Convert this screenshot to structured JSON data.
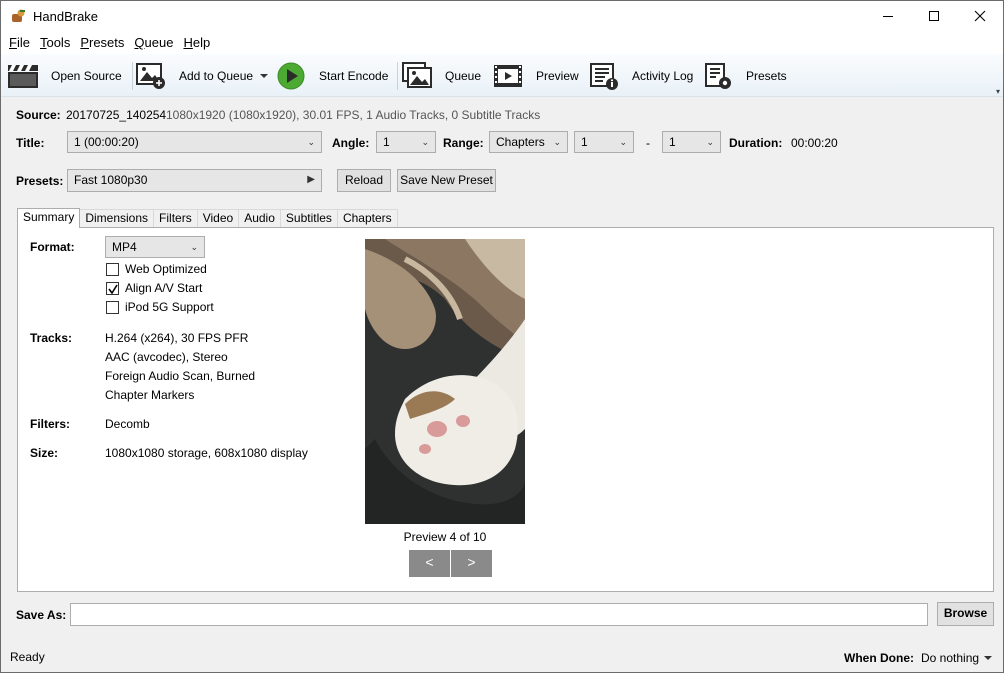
{
  "window": {
    "title": "HandBrake"
  },
  "menu": [
    {
      "label": "File",
      "key": "F",
      "rest": "ile"
    },
    {
      "label": "Tools",
      "key": "T",
      "rest": "ools"
    },
    {
      "label": "Presets",
      "key": "P",
      "rest": "resets"
    },
    {
      "label": "Queue",
      "key": "Q",
      "rest": "ueue"
    },
    {
      "label": "Help",
      "key": "H",
      "rest": "elp"
    }
  ],
  "toolbar": {
    "open_source": "Open Source",
    "add_to_queue": "Add to Queue",
    "start_encode": "Start Encode",
    "queue": "Queue",
    "preview": "Preview",
    "activity_log": "Activity Log",
    "presets": "Presets"
  },
  "source": {
    "label": "Source:",
    "name": "20170725_140254",
    "info": "1080x1920 (1080x1920), 30.01 FPS, 1 Audio Tracks, 0 Subtitle Tracks"
  },
  "title_row": {
    "title_label": "Title:",
    "title_value": "1 (00:00:20)",
    "angle_label": "Angle:",
    "angle_value": "1",
    "range_label": "Range:",
    "range_mode": "Chapters",
    "range_start": "1",
    "range_dash": "-",
    "range_end": "1",
    "duration_label": "Duration:",
    "duration_value": "00:00:20"
  },
  "presets_row": {
    "label": "Presets:",
    "value": "Fast 1080p30",
    "reload": "Reload",
    "save_new": "Save New Preset"
  },
  "tabs": [
    "Summary",
    "Dimensions",
    "Filters",
    "Video",
    "Audio",
    "Subtitles",
    "Chapters"
  ],
  "summary": {
    "format_label": "Format:",
    "format_value": "MP4",
    "options": [
      {
        "label": "Web Optimized",
        "checked": false
      },
      {
        "label": "Align A/V Start",
        "checked": true
      },
      {
        "label": "iPod 5G Support",
        "checked": false
      }
    ],
    "tracks_label": "Tracks:",
    "tracks": [
      "H.264 (x264), 30 FPS PFR",
      "AAC (avcodec), Stereo",
      "Foreign Audio Scan, Burned",
      "Chapter Markers"
    ],
    "filters_label": "Filters:",
    "filters_value": "Decomb",
    "size_label": "Size:",
    "size_value": "1080x1080 storage, 608x1080 display",
    "preview_caption": "Preview 4 of 10",
    "prev_btn": "<",
    "next_btn": ">"
  },
  "save_as": {
    "label": "Save As:",
    "value": "",
    "browse": "Browse"
  },
  "status": {
    "text": "Ready",
    "when_done_label": "When Done:",
    "when_done_value": "Do nothing"
  }
}
